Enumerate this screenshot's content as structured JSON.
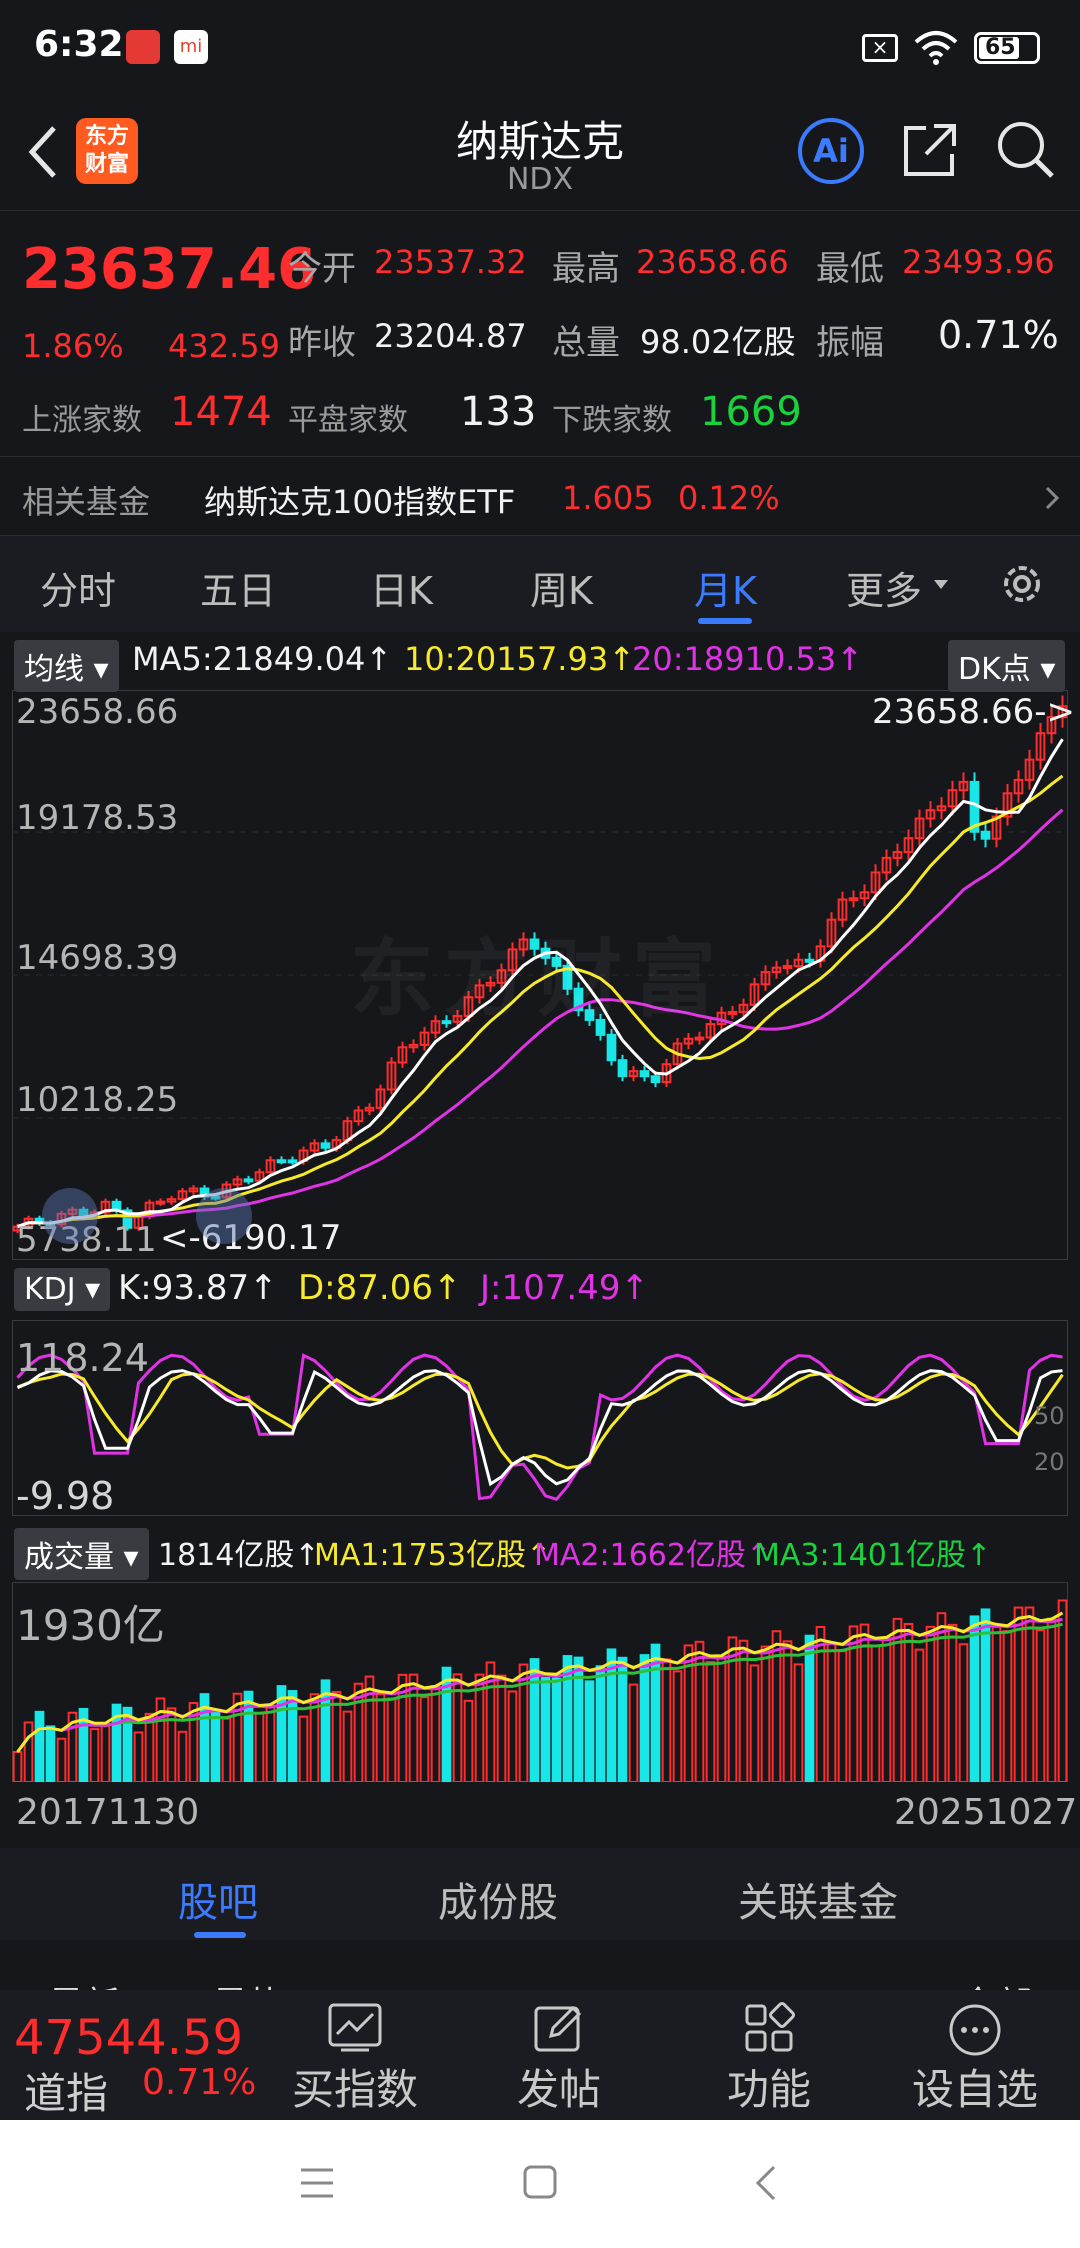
{
  "status": {
    "time": "6:32",
    "battery": "65"
  },
  "header": {
    "title": "纳斯达克",
    "subtitle": "NDX",
    "logo_line1": "东方",
    "logo_line2": "财富",
    "ai_label": "Ai"
  },
  "quote": {
    "price": "23637.46",
    "change_pct": "1.86%",
    "change": "432.59",
    "open_label": "今开",
    "open": "23537.32",
    "high_label": "最高",
    "high": "23658.66",
    "low_label": "最低",
    "low": "23493.96",
    "prev_close_label": "昨收",
    "prev_close": "23204.87",
    "volume_label": "总量",
    "volume": "98.02亿股",
    "amplitude_label": "振幅",
    "amplitude": "0.71%",
    "up_label": "上涨家数",
    "up": "1474",
    "flat_label": "平盘家数",
    "flat": "133",
    "down_label": "下跌家数",
    "down": "1669"
  },
  "fund": {
    "label": "相关基金",
    "name": "纳斯达克100指数ETF",
    "price": "1.605",
    "pct": "0.12%"
  },
  "periods": [
    "分时",
    "五日",
    "日K",
    "周K",
    "月K",
    "更多"
  ],
  "kline": {
    "indicator": "均线",
    "ma5": "MA5:21849.04",
    "ma10": "10:20157.93",
    "ma20": "20:18910.53",
    "dk": "DK点",
    "y_labels": [
      "23658.66",
      "19178.53",
      "14698.39",
      "10218.25",
      "5738.11"
    ],
    "max_marker": "23658.66->",
    "min_marker": "<-6190.17",
    "watermark": "东方财富"
  },
  "kdj": {
    "indicator": "KDJ",
    "k": "K:93.87",
    "d": "D:87.06",
    "j": "J:107.49",
    "top": "118.24",
    "bottom": "-9.98",
    "l50": "50",
    "l20": "20"
  },
  "volume": {
    "indicator": "成交量",
    "v": "1814亿股",
    "ma1": "MA1:1753亿股",
    "ma2": "MA2:1662亿股",
    "ma3": "MA3:1401亿股",
    "top": "1930亿"
  },
  "dates": {
    "start": "20171130",
    "end": "20251027"
  },
  "bottom_tabs": [
    "股吧",
    "成份股",
    "关联基金"
  ],
  "sub_peek": {
    "left1": "最新",
    "left2": "最热",
    "right": "全部"
  },
  "bottom_bar": {
    "index_price": "47544.59",
    "index_name": "道指",
    "index_pct": "0.71%",
    "buy": "买指数",
    "post": "发帖",
    "func": "功能",
    "watch": "设自选"
  },
  "colors": {
    "up": "#ff2d2d",
    "down": "#19e6e6",
    "green": "#19d23c",
    "bg": "#16171b",
    "accent": "#3a7bff"
  }
}
